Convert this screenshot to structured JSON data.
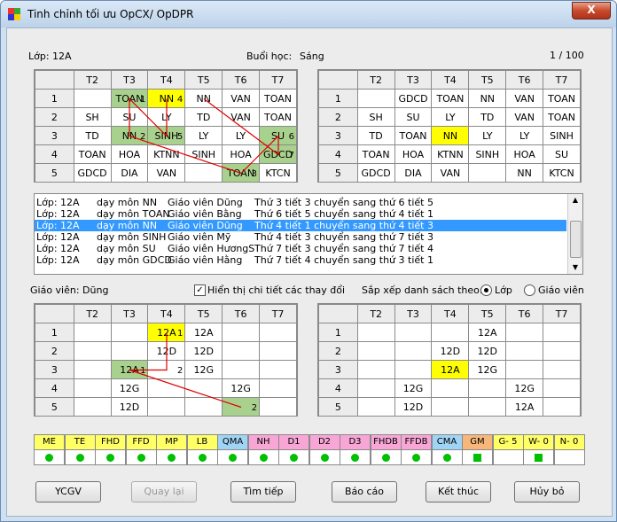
{
  "window": {
    "title": "Tinh chỉnh tối ưu OpCX/ OpDPR",
    "close": "X"
  },
  "header": {
    "class_label": "Lớp: 12A",
    "session_label": "Buổi học:",
    "session_value": "Sáng",
    "page": "1 / 100"
  },
  "day_headers": [
    "T2",
    "T3",
    "T4",
    "T5",
    "T6",
    "T7"
  ],
  "periods": [
    "1",
    "2",
    "3",
    "4",
    "5"
  ],
  "class_before": [
    [
      "",
      "TOAN",
      "NN",
      "NN",
      "VAN",
      "TOAN"
    ],
    [
      "SH",
      "SU",
      "LY",
      "TD",
      "VAN",
      "TOAN"
    ],
    [
      "TD",
      "NN",
      "SINH",
      "LY",
      "LY",
      "SU"
    ],
    [
      "TOAN",
      "HOA",
      "KTNN",
      "SINH",
      "HOA",
      "GDCD"
    ],
    [
      "GDCD",
      "DIA",
      "VAN",
      "",
      "TOAN",
      "KTCN"
    ]
  ],
  "class_before_marks": {
    "r0c1": "1",
    "r0c2": "4",
    "r2c1": "2",
    "r2c2": "5",
    "r2c5": "6",
    "r3c5": "7",
    "r4c4": "3"
  },
  "class_after": [
    [
      "",
      "GDCD",
      "TOAN",
      "NN",
      "VAN",
      "TOAN"
    ],
    [
      "SH",
      "SU",
      "LY",
      "TD",
      "VAN",
      "TOAN"
    ],
    [
      "TD",
      "TOAN",
      "NN",
      "LY",
      "LY",
      "SINH"
    ],
    [
      "TOAN",
      "HOA",
      "KTNN",
      "SINH",
      "HOA",
      "SU"
    ],
    [
      "GDCD",
      "DIA",
      "VAN",
      "",
      "NN",
      "KTCN"
    ]
  ],
  "log": [
    {
      "cls": "Lớp: 12A",
      "subj": "dạy môn NN",
      "teacher": "Giáo viên Dũng",
      "move": "Thứ 3 tiết 3 chuyển sang thứ 6 tiết 5"
    },
    {
      "cls": "Lớp: 12A",
      "subj": "dạy môn TOAN",
      "teacher": "Giáo viên Bằng",
      "move": "Thứ 6 tiết 5 chuyển sang thứ 4 tiết 1"
    },
    {
      "cls": "Lớp: 12A",
      "subj": "dạy môn NN",
      "teacher": "Giáo viên Dũng",
      "move": "Thứ 4 tiết 1 chuyển sang thứ 4 tiết 3"
    },
    {
      "cls": "Lớp: 12A",
      "subj": "dạy môn SINH",
      "teacher": "Giáo viên Mỹ",
      "move": "Thứ 4 tiết 3 chuyển sang thứ 7 tiết 3"
    },
    {
      "cls": "Lớp: 12A",
      "subj": "dạy môn SU",
      "teacher": "Giáo viên HươngS",
      "move": "Thứ 7 tiết 3 chuyển sang thứ 7 tiết 4"
    },
    {
      "cls": "Lớp: 12A",
      "subj": "dạy môn GDCD",
      "teacher": "Giáo viên Hằng",
      "move": "Thứ 7 tiết 4 chuyển sang thứ 3 tiết 1"
    }
  ],
  "log_selected": 2,
  "options": {
    "teacher_label": "Giáo viên: Dũng",
    "show_detail": "Hiển thị chi tiết các thay đổi",
    "sort_label": "Sắp xếp danh sách theo:",
    "sort_class": "Lớp",
    "sort_teacher": "Giáo viên"
  },
  "teacher_before": [
    [
      "",
      "",
      "12A",
      "12A",
      "",
      ""
    ],
    [
      "",
      "",
      "12D",
      "12D",
      "",
      ""
    ],
    [
      "",
      "12A",
      "",
      "12G",
      "",
      ""
    ],
    [
      "",
      "12G",
      "",
      "",
      "12G",
      ""
    ],
    [
      "",
      "12D",
      "",
      "",
      "",
      ""
    ]
  ],
  "teacher_before_marks": {
    "r0c2": "1",
    "r2c1": "1",
    "r2c2": "2",
    "r4c4": "2"
  },
  "teacher_after": [
    [
      "",
      "",
      "",
      "12A",
      "",
      ""
    ],
    [
      "",
      "",
      "12D",
      "12D",
      "",
      ""
    ],
    [
      "",
      "",
      "12A",
      "12G",
      "",
      ""
    ],
    [
      "",
      "12G",
      "",
      "",
      "12G",
      ""
    ],
    [
      "",
      "12D",
      "",
      "",
      "12A",
      ""
    ]
  ],
  "criteria": [
    {
      "label": "ME",
      "color": "#ffff66",
      "mark": "dot"
    },
    {
      "label": "TE",
      "color": "#ffff66",
      "mark": "dot"
    },
    {
      "label": "FHD",
      "color": "#ffff66",
      "mark": "dot"
    },
    {
      "label": "FFD",
      "color": "#ffff66",
      "mark": "dot"
    },
    {
      "label": "MP",
      "color": "#ffff66",
      "mark": "dot"
    },
    {
      "label": "LB",
      "color": "#ffff66",
      "mark": "dot"
    },
    {
      "label": "QMA",
      "color": "#9fd4f5",
      "mark": "dot"
    },
    {
      "label": "NH",
      "color": "#f7a6d6",
      "mark": "dot"
    },
    {
      "label": "D1",
      "color": "#f7a6d6",
      "mark": "dot"
    },
    {
      "label": "D2",
      "color": "#f7a6d6",
      "mark": "dot"
    },
    {
      "label": "D3",
      "color": "#f7a6d6",
      "mark": "dot"
    },
    {
      "label": "FHDB",
      "color": "#f7a6d6",
      "mark": "dot"
    },
    {
      "label": "FFDB",
      "color": "#f7a6d6",
      "mark": "dot"
    },
    {
      "label": "CMA",
      "color": "#9fd4f5",
      "mark": "dot"
    },
    {
      "label": "GM",
      "color": "#f7b77a",
      "mark": "square"
    },
    {
      "label": "G- 5",
      "color": "#ffff66",
      "mark": ""
    },
    {
      "label": "W- 0",
      "color": "#ffff66",
      "mark": "square"
    },
    {
      "label": "N- 0",
      "color": "#ffff66",
      "mark": ""
    }
  ],
  "buttons": {
    "ycgv": "YCGV",
    "back": "Quay lại",
    "next": "Tìm tiếp",
    "report": "Báo cáo",
    "finish": "Kết thúc",
    "cancel": "Hủy bỏ"
  },
  "colors": {
    "moved_cell": "#a9d18e",
    "target_cell": "#ffff00",
    "path_line": "#e00000",
    "selection": "#3399ff"
  }
}
